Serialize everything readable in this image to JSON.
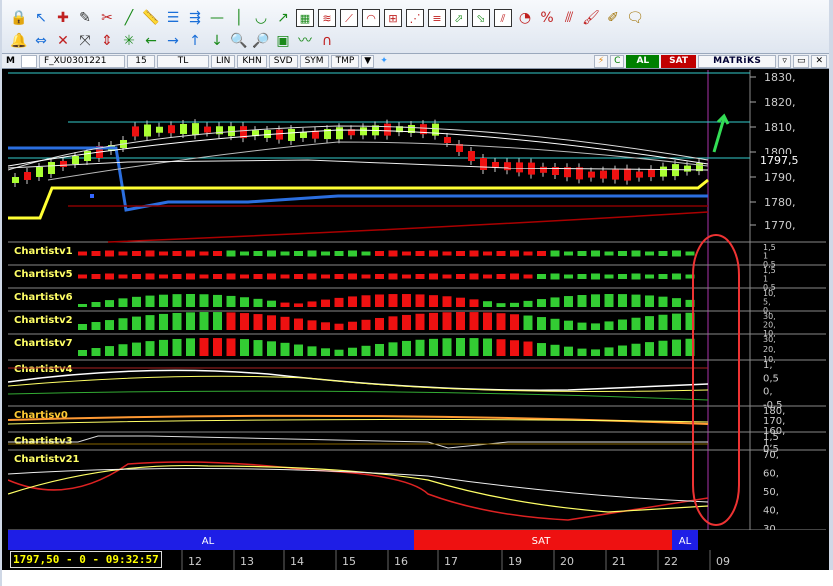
{
  "toolbar": {
    "row1": [
      "lock-icon",
      "arrow-cursor-icon",
      "crosshair-icon",
      "pencil-icon",
      "tools-icon",
      "draw-line-icon",
      "ruler-icon",
      "horizontal-lines-icon",
      "channel-icon",
      "dash-icon",
      "vertical-line-icon",
      "cup-icon",
      "trend-up-icon",
      "grid-icon",
      "fibonacci-icon",
      "fan-icon",
      "fib-arc-icon",
      "gann-icon",
      "speed-lines-icon",
      "regression-icon",
      "arrow-up-icon",
      "arrow-down-icon",
      "andrews-icon",
      "cycle-icon",
      "percent-icon",
      "strike-icon",
      "paint-icon",
      "highlight-icon",
      "note-icon"
    ],
    "row2": [
      "bell-icon",
      "double-arrow-h-icon",
      "expand-icon",
      "collapse-icon",
      "double-arrow-v-icon",
      "sparkle-icon",
      "arrow-left-icon",
      "arrow-right-icon",
      "arrow-up-small-icon",
      "arrow-down-small-icon",
      "zoom-in-icon",
      "zoom-out-icon",
      "chart-window-icon",
      "wave-icon",
      "magnet-icon"
    ]
  },
  "infobar": {
    "symbol": "F_XU0301221",
    "period": "15",
    "currency": "TL",
    "lin": "LIN",
    "khn": "KHN",
    "svd": "SVD",
    "sym": "SYM",
    "tmp": "TMP",
    "al": "AL",
    "sat": "SAT",
    "brand": "MATRiKS"
  },
  "price_axis": [
    "1830,",
    "1820,",
    "1810,",
    "1800,",
    "1790,",
    "1780,",
    "1770,"
  ],
  "price_label": "1797,5",
  "indicators": [
    {
      "name": "Chartistv1",
      "scale": [
        "1,5",
        "1",
        "0,5"
      ]
    },
    {
      "name": "Chartistv5",
      "scale": [
        "1,5",
        "1",
        "0,5"
      ]
    },
    {
      "name": "Chartistv6",
      "scale": [
        "10,",
        "5,",
        "0,"
      ]
    },
    {
      "name": "Chartistv2",
      "scale": [
        "30,",
        "20,",
        "10,"
      ]
    },
    {
      "name": "Chartistv7",
      "scale": [
        "30,",
        "20,",
        "10,"
      ]
    },
    {
      "name": "Chartistv4",
      "scale": [
        "1,",
        "0,5",
        "0,",
        "-0,5"
      ]
    },
    {
      "name": "Chartisv0",
      "scale": [
        "180,",
        "170,",
        "160,"
      ]
    },
    {
      "name": "Chartistv3",
      "scale": [
        "1,5",
        "1,",
        "0,5"
      ]
    },
    {
      "name": "Chartistv21",
      "scale": [
        "70,",
        "60,",
        "50,",
        "40,",
        "30,"
      ]
    }
  ],
  "signals": {
    "al_left": "AL",
    "sat": "SAT",
    "al_right": "AL"
  },
  "time_axis": [
    "12",
    "13",
    "14",
    "15",
    "16",
    "17",
    "19",
    "20",
    "21",
    "22",
    "09"
  ],
  "status": "1797,50 - 0 - 09:32:57",
  "colors": {
    "bull": "#33cc33",
    "bear": "#ee1111",
    "blue_line": "#2b6fe0",
    "yellow_line": "#ffff33",
    "signal_blue": "#1e1ee6",
    "signal_red": "#ee1111",
    "axis_text": "#cccccc"
  }
}
